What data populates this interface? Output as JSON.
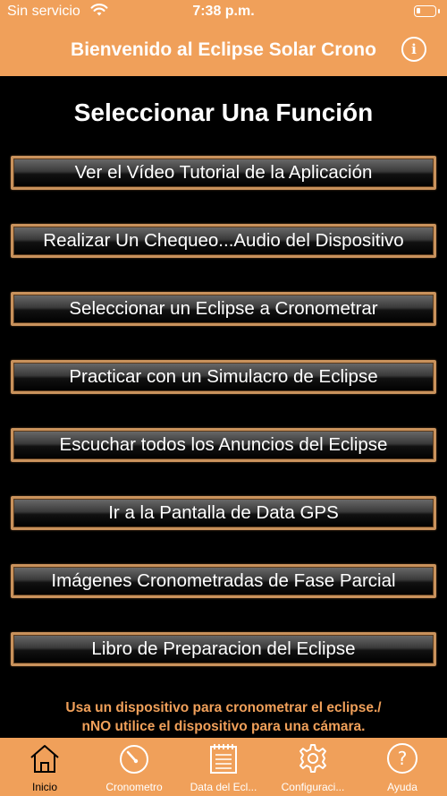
{
  "status_bar": {
    "carrier": "Sin servicio",
    "time": "7:38 p.m."
  },
  "nav": {
    "title": "Bienvenido al Eclipse Solar Crono",
    "info_icon": "info-circle-icon"
  },
  "heading": "Seleccionar Una Función",
  "menu": [
    "Ver el Vídeo Tutorial de la Aplicación",
    "Realizar Un Chequeo...Audio del Dispositivo",
    "Seleccionar un Eclipse a Cronometrar",
    "Practicar con un Simulacro de Eclipse",
    "Escuchar todos los Anuncios del Eclipse",
    "Ir a la Pantalla de Data GPS",
    "Imágenes Cronometradas de Fase Parcial",
    "Libro de Preparacion del Eclipse"
  ],
  "footer_note": {
    "line1": "Usa un dispositivo para cronometrar el eclipse./",
    "line2": "nNO utilice el dispositivo para una cámara."
  },
  "tabs": [
    {
      "label": "Inicio",
      "icon": "home-icon",
      "active": true
    },
    {
      "label": "Cronometro",
      "icon": "stopwatch-icon",
      "active": false
    },
    {
      "label": "Data del Ecl...",
      "icon": "notepad-icon",
      "active": false
    },
    {
      "label": "Configuraci...",
      "icon": "gear-icon",
      "active": false
    },
    {
      "label": "Ayuda",
      "icon": "help-icon",
      "active": false
    }
  ],
  "colors": {
    "accent": "#f0a05a",
    "button_border": "#c9925c",
    "background": "#000000"
  }
}
